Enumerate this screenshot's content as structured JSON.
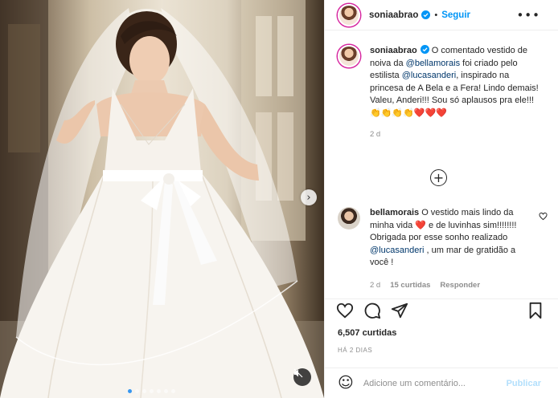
{
  "post": {
    "username": "soniaabrao",
    "follow_label": "Seguir",
    "separator": "•",
    "more_label": "•••"
  },
  "caption": {
    "username": "soniaabrao",
    "text_1": " O comentado vestido de noiva da ",
    "mention_1": "@bellamorais",
    "text_2": " foi criado pelo estilista ",
    "mention_2": "@lucasanderi",
    "text_3": ", inspirado na princesa de A Bela e a Fera! Lindo demais! Valeu, Anderi!!! Sou só aplausos pra ele!!! ",
    "emoji": "👏👏👏👏❤️❤️❤️",
    "time": "2 d"
  },
  "comment": {
    "username": "bellamorais",
    "text_1": " O vestido mais lindo da minha vida ",
    "emoji_1": "❤️",
    "text_2": " e de luvinhas sim!!!!!!!! Obrigada por esse sonho realizado ",
    "mention": "@lucasanderi",
    "text_3": " , um mar de gratidão a você !",
    "time": "2 d",
    "likes": "15 curtidas",
    "reply_label": "Responder"
  },
  "load_more_label": "+",
  "likes_count": "6,507 curtidas",
  "posted_ago": "HÁ 2 DIAS",
  "add_comment": {
    "emoji_icon": "☺",
    "placeholder": "Adicione um comentário...",
    "publish_label": "Publicar"
  },
  "carousel": {
    "next_arrow": "›",
    "slide_count": 7,
    "active_slide": 1
  },
  "colors": {
    "link_blue": "#0095f6",
    "mention_blue": "#00376b",
    "muted_gray": "#8e8e8e",
    "publish_disabled": "#b2dffc",
    "story_ring": "#d6249f"
  }
}
